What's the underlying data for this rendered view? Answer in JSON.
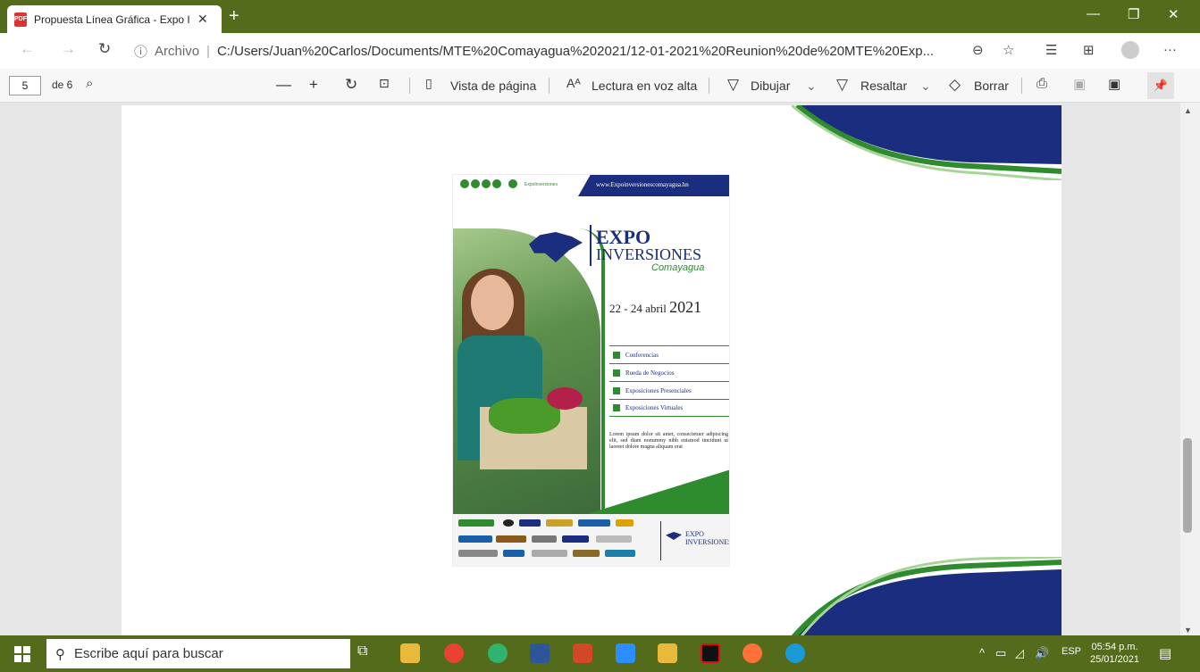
{
  "tab": {
    "title": "Propuesta Línea Gráfica - Expo Inversiones",
    "close": "✕",
    "new": "+"
  },
  "window": {
    "minimize": "—",
    "restore": "❐",
    "close": "✕"
  },
  "address": {
    "info": "ⓘ",
    "archivo": "Archivo",
    "url": "C:/Users/Juan%20Carlos/Documents/MTE%20Comayagua%202021/12-01-2021%20Reunion%20de%20MTE%20Exp..."
  },
  "pdf_toolbar": {
    "page": "5",
    "of": "de 6",
    "page_view": "Vista de página",
    "read_aloud": "Lectura en voz alta",
    "draw": "Dibujar",
    "highlight": "Resaltar",
    "erase": "Borrar"
  },
  "poster": {
    "url": "www.Expoinversionescomayagua.hn",
    "social": "ExpoInversiones",
    "expo": "EXPO",
    "inversiones": "INVERSIONES",
    "comayagua": "Comayagua",
    "date_days": "22 - 24 abril",
    "date_year": "2021",
    "items": [
      "Conferencias",
      "Rueda de Negocios",
      "Exposiciones Presenciales",
      "Exposiciones Virtuales"
    ],
    "lorem": "Lorem ipsum dolor sit amet, consectetuer adipiscing elit, sed diam nonummy nibh euismod tincidunt ut laoreet dolore magna aliquam erat",
    "logo_expo": "EXPO INVERSIONES"
  },
  "taskbar": {
    "search_placeholder": "Escribe aquí para buscar",
    "lang": "ESP",
    "time": "05:54 p.m.",
    "date": "25/01/2021"
  },
  "colors": {
    "titlebar": "#556b1c",
    "navy": "#1b2d7e",
    "green": "#2e8b2e"
  },
  "icons": [
    "pdf-icon",
    "back-icon",
    "forward-icon",
    "reload-icon",
    "zoom-icon",
    "favorite-icon",
    "collections-icon",
    "profile-icon",
    "more-icon",
    "search-icon",
    "zoom-out-icon",
    "zoom-in-icon",
    "rotate-icon",
    "fit-icon",
    "read-aloud-icon",
    "draw-icon",
    "highlight-icon",
    "erase-icon",
    "print-icon",
    "save-icon",
    "save-as-icon",
    "pin-icon",
    "windows-icon"
  ]
}
